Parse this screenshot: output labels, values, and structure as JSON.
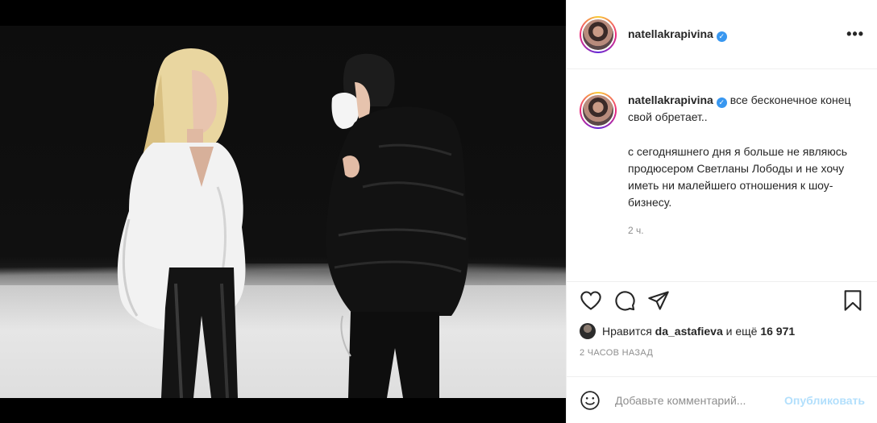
{
  "post": {
    "author": {
      "username": "natellakrapivina",
      "verified_icon": "verified-badge-icon",
      "avatar_icon": "profile-avatar"
    },
    "more_label": "•••",
    "caption": {
      "line1": "все бесконечное конец свой обретает..",
      "paragraph": "с сегодняшнего дня я больше не являюсь продюсером Светланы Лободы и не хочу иметь ни малейшего отношения к шоу-бизнесу.",
      "time": "2 ч."
    },
    "actions": {
      "like_icon": "heart-icon",
      "comment_icon": "comment-icon",
      "share_icon": "share-icon",
      "save_icon": "bookmark-icon"
    },
    "likes": {
      "prefix": "Нравится",
      "user": "da_astafieva",
      "and_more": "и ещё",
      "count": "16 971"
    },
    "time_ago": "2 ЧАСОВ НАЗАД",
    "comment": {
      "placeholder": "Добавьте комментарий...",
      "publish_label": "Опубликовать"
    }
  },
  "colors": {
    "accent": "#0095f6",
    "verified": "#3897f0",
    "publish_disabled": "#b2dffc",
    "secondary_text": "#8e8e8e",
    "border": "#efefef"
  }
}
